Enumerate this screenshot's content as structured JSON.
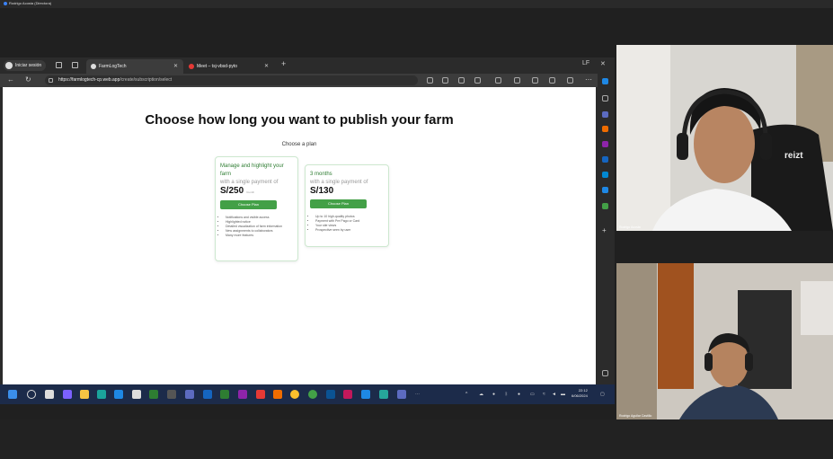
{
  "call": {
    "title": "Rodrigo Acosta (Directora)"
  },
  "browser": {
    "signin_label": "Iniciar sesión",
    "tabs": [
      {
        "label": "FarmLogTech"
      },
      {
        "label": "Meet – tsj-vbsd-pyto"
      }
    ],
    "url_domain": "https://farmlogtech-cp.web.app",
    "url_path": "/create/subscription/select",
    "window_controls": [
      "LF",
      "✕"
    ]
  },
  "page": {
    "title": "Choose how long you want to publish your farm",
    "subtitle": "Choose a plan",
    "plans": [
      {
        "heading": "Manage and highlight your farm",
        "sub": "with a single payment of",
        "price": "S/250",
        "price_note": "/month",
        "button": "Choose Plan",
        "features": [
          "Notifications and visible access",
          "Highlighted notice",
          "Detailed visualization of farm information",
          "New assignments to collaborators",
          "Many more features"
        ]
      },
      {
        "heading": "3 months",
        "sub": "with a single payment of",
        "price": "S/130",
        "price_note": "",
        "button": "Choose Plan",
        "features": [
          "Up to 10 high-quality photos",
          "Payment with Pre Pago or Card",
          "Your site views",
          "Prospective seen by user"
        ]
      }
    ]
  },
  "taskbar": {
    "time": "22:12",
    "date": "6/06/2024"
  },
  "participants": [
    {
      "name": "Rodrigo Acosta",
      "shirt_text": "reizt"
    },
    {
      "name": "Rodrigo Aguilar Castillo"
    }
  ],
  "colors": {
    "accent_green": "#43a047",
    "taskbar": "#1c2b4a"
  }
}
